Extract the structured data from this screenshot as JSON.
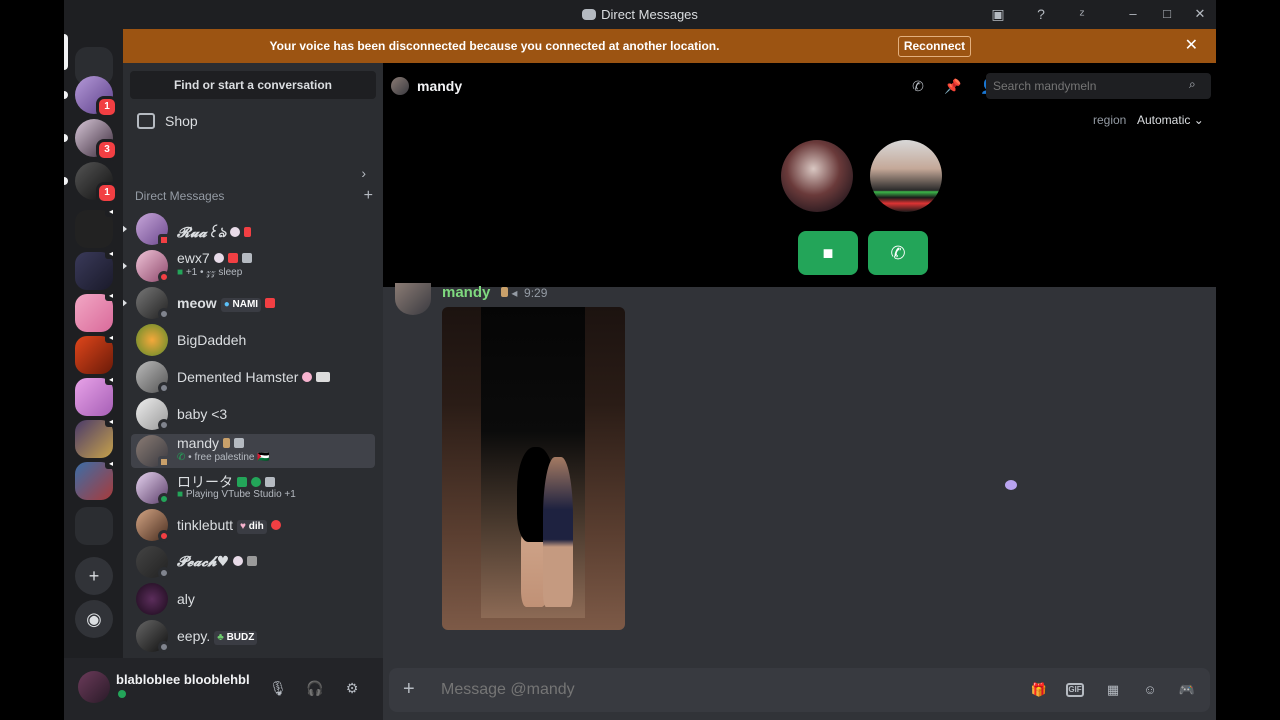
{
  "window": {
    "title": "Direct Messages"
  },
  "banner": {
    "message": "Your voice has been disconnected because you connected at another location.",
    "reconnect_label": "Reconnect"
  },
  "servers": [
    {
      "badge": "1"
    },
    {
      "badge": "3"
    },
    {
      "badge": "1"
    }
  ],
  "sidebar": {
    "search_label": "Find or start a conversation",
    "shop_label": "Shop",
    "section_title": "Direct Messages",
    "dms": [
      {
        "name": "𝓡𝓾𝓪꒰ঌ",
        "tag": ""
      },
      {
        "name": "ewx7",
        "sub": "+1 • 𝓏𝓏 sleep"
      },
      {
        "name": "meow",
        "tag": "NAMI"
      },
      {
        "name": "BigDaddeh"
      },
      {
        "name": "Demented Hamster"
      },
      {
        "name": "baby <3"
      },
      {
        "name": "mandy",
        "sub": "• free palestine 🇵🇸"
      },
      {
        "name": "ロリータ",
        "sub": "Playing VTube Studio +1"
      },
      {
        "name": "tinklebutt",
        "tag": "dih"
      },
      {
        "name": "𝓟𝓮𝓪𝓬𝓱♥"
      },
      {
        "name": "aly"
      },
      {
        "name": "eepy.",
        "tag": "BUDZ"
      }
    ]
  },
  "user": {
    "name": "blabloblee blooblehbl"
  },
  "channel": {
    "name": "mandy",
    "search_placeholder": "Search mandymeln",
    "region_label": "region",
    "region_value": "Automatic"
  },
  "message": {
    "author": "mandy",
    "time": "9:29"
  },
  "composer": {
    "placeholder": "Message @mandy"
  },
  "colors": {
    "accent": "#23a559",
    "banner": "#9c5412",
    "author": "#7fd97f"
  }
}
